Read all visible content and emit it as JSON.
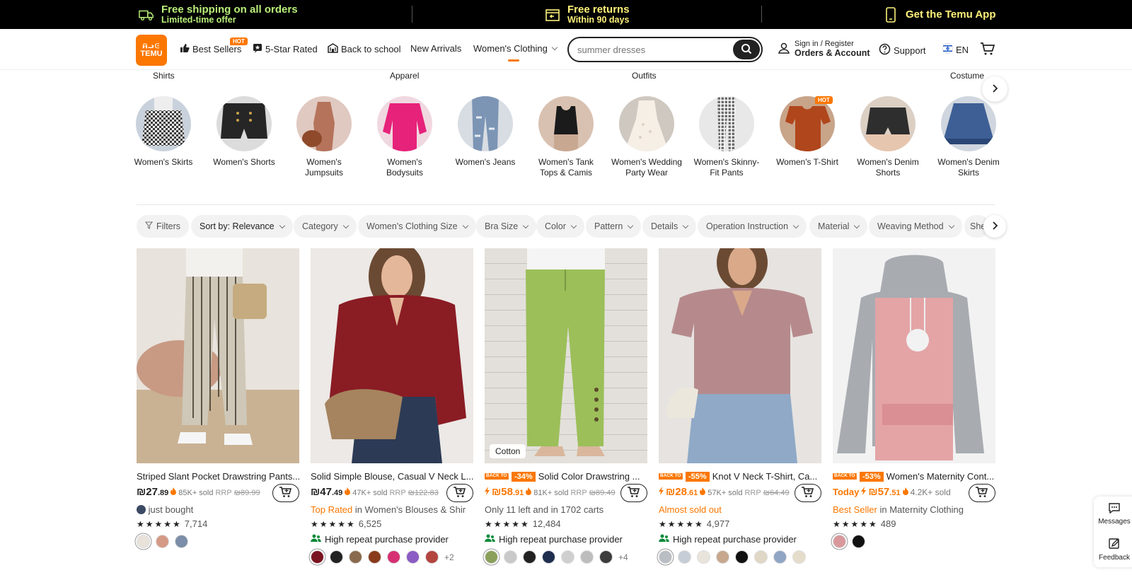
{
  "promo": {
    "shipping_title": "Free shipping on all orders",
    "shipping_sub": "Limited-time offer",
    "returns_title": "Free returns",
    "returns_sub": "Within 90 days",
    "app": "Get the Temu App"
  },
  "header": {
    "logo_top": "ᕱᓗᕮ",
    "logo_text": "TEMU",
    "nav": {
      "best_sellers": "Best Sellers",
      "hot": "HOT",
      "five_star": "5-Star Rated",
      "back_to_school": "Back to school",
      "new_arrivals": "New Arrivals",
      "womens_clothing": "Women's Clothing"
    },
    "search_placeholder": "summer dresses",
    "sign_in": "Sign in / Register",
    "orders": "Orders & Account",
    "support": "Support",
    "lang": "EN"
  },
  "categories": {
    "top_labels": [
      "Shirts",
      "Apparel",
      "Outfits",
      "Costume"
    ],
    "items": [
      {
        "label": "Women's Skirts"
      },
      {
        "label": "Women's Shorts"
      },
      {
        "label": "Women's Jumpsuits"
      },
      {
        "label": "Women's Bodysuits"
      },
      {
        "label": "Women's Jeans"
      },
      {
        "label": "Women's Tank Tops & Camis"
      },
      {
        "label": "Women's Wedding Party Wear"
      },
      {
        "label": "Women's Skinny-Fit Pants"
      },
      {
        "label": "Women's T-Shirt",
        "hot": "HOT"
      },
      {
        "label": "Women's Denim Shorts"
      },
      {
        "label": "Women's Denim Skirts"
      }
    ]
  },
  "filters": {
    "filters": "Filters",
    "sort": "Sort by: Relevance",
    "category": "Category",
    "size": "Women's Clothing Size",
    "bra": "Bra Size",
    "color": "Color",
    "pattern": "Pattern",
    "details": "Details",
    "operation": "Operation Instruction",
    "material": "Material",
    "weaving": "Weaving Method",
    "sheer": "She"
  },
  "products": [
    {
      "title": "Striped Slant Pocket Drawstring Pants...",
      "price_int": "₪27",
      "price_dec": ".89",
      "sold": "85K+ sold",
      "rrp_label": "RRP",
      "rrp": "₪89.99",
      "sub": "just bought",
      "rating": "7,714",
      "swatches": [
        "#e8e2da",
        "#d49a86",
        "#7b8da8"
      ]
    },
    {
      "title": "Solid Simple Blouse, Casual V Neck L...",
      "price_int": "₪47",
      "price_dec": ".49",
      "sold": "47K+ sold",
      "rrp_label": "RRP",
      "rrp": "₪122.83",
      "sub_or": "Top Rated",
      "sub": "in Women's Blouses & Shir",
      "rating": "6,525",
      "repeat": "High repeat purchase provider",
      "swatches": [
        "#7a1420",
        "#222222",
        "#8a6a4d",
        "#8a3b1b",
        "#d63072",
        "#8b5cc4",
        "#b3453f"
      ],
      "more": "+2"
    },
    {
      "badge1": "BACK TO SCHOOL",
      "discount": "-34%",
      "title": "Solid Color Drawstring ...",
      "price_int": "₪58",
      "price_dec": ".91",
      "sold": "81K+ sold",
      "rrp_label": "RRP",
      "rrp": "₪89.49",
      "sub": "Only 11 left and in 1702 carts",
      "rating": "12,484",
      "repeat": "High repeat purchase provider",
      "tag": "Cotton",
      "swatches": [
        "#8aa05a",
        "#c9c9c9",
        "#222222",
        "#1f2e4f",
        "#cfcfcf",
        "#bdbdbd",
        "#3c3c3c"
      ],
      "more": "+4"
    },
    {
      "badge1": "BACK TO SCHOOL",
      "discount": "-55%",
      "title": "Knot V Neck T-Shirt, Ca...",
      "price_int": "₪28",
      "price_dec": ".61",
      "sold": "57K+ sold",
      "rrp_label": "RRP",
      "rrp": "₪64.49",
      "sub_or": "Almost sold out",
      "rating": "4,977",
      "repeat": "High repeat purchase provider",
      "swatches": [
        "#b9bec4",
        "#c7cdd6",
        "#e8e4dc",
        "#c7a88e",
        "#111111",
        "#e1d7c6",
        "#8fa5c4",
        "#e6dccb"
      ]
    },
    {
      "badge1": "BACK TO SCHOOL",
      "discount": "-53%",
      "title": "Women's Maternity Cont...",
      "price_prefix": "Today",
      "price_int": "₪57",
      "price_dec": ".51",
      "sold": "4.2K+ sold",
      "sub_or": "Best Seller",
      "sub": "in Maternity Clothing",
      "rating": "489",
      "swatches": [
        "#d9989b",
        "#111111"
      ]
    }
  ],
  "side": {
    "messages": "Messages",
    "feedback": "Feedback"
  }
}
